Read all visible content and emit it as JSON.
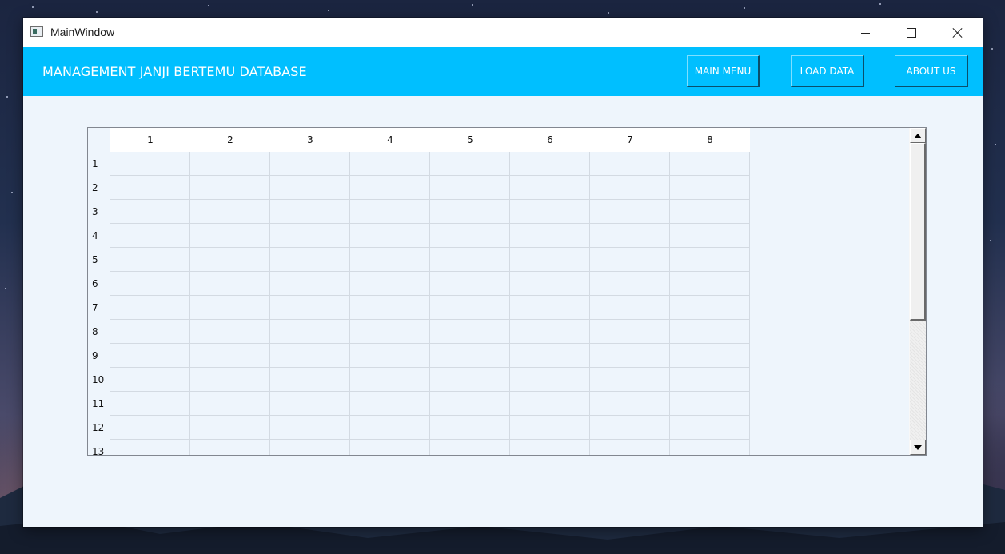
{
  "window": {
    "title": "MainWindow"
  },
  "header": {
    "title": "MANAGEMENT JANJI BERTEMU DATABASE",
    "buttons": {
      "main_menu": "MAIN MENU",
      "load_data": "LOAD DATA",
      "about_us": "ABOUT US"
    },
    "color": "#00BFFF"
  },
  "table": {
    "columns": [
      "1",
      "2",
      "3",
      "4",
      "5",
      "6",
      "7",
      "8"
    ],
    "rows": [
      "1",
      "2",
      "3",
      "4",
      "5",
      "6",
      "7",
      "8",
      "9",
      "10",
      "11",
      "12",
      "13"
    ],
    "scroll_position": 0.0
  }
}
